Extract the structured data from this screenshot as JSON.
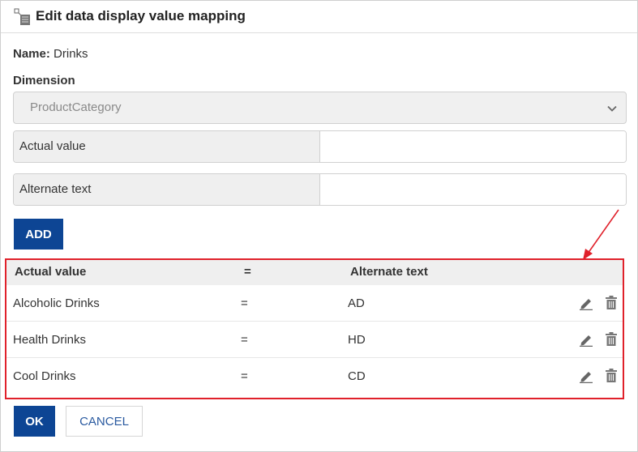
{
  "dialog": {
    "title": "Edit data display value mapping",
    "title_icon": "mapping-icon"
  },
  "name": {
    "label": "Name:",
    "value": "Drinks"
  },
  "dimension": {
    "label": "Dimension",
    "selected": "ProductCategory"
  },
  "form": {
    "actual_label": "Actual value",
    "actual_value": "",
    "alternate_label": "Alternate text",
    "alternate_value": "",
    "add_label": "ADD"
  },
  "table": {
    "headers": {
      "actual": "Actual value",
      "equals": "=",
      "alternate": "Alternate text"
    },
    "rows": [
      {
        "actual": "Alcoholic Drinks",
        "equals": "=",
        "alternate": "AD"
      },
      {
        "actual": "Health Drinks",
        "equals": "=",
        "alternate": "HD"
      },
      {
        "actual": "Cool Drinks",
        "equals": "=",
        "alternate": "CD"
      }
    ]
  },
  "footer": {
    "ok_label": "OK",
    "cancel_label": "CANCEL"
  },
  "colors": {
    "primary_button": "#0d4594",
    "annotation_red": "#e0212b",
    "cancel_text": "#2a5aa0"
  }
}
